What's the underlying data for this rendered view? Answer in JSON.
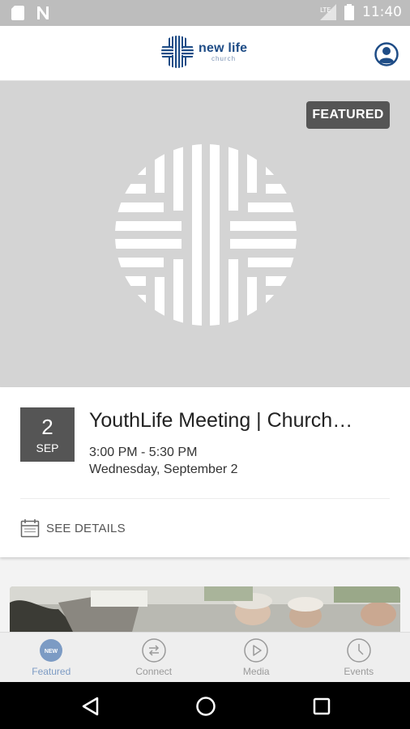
{
  "status_bar": {
    "time": "11:40",
    "icons": [
      "sd-card-icon",
      "notification-n-icon",
      "signal-icon",
      "battery-icon"
    ]
  },
  "app_bar": {
    "logo_text": "new life",
    "logo_subtext": "church",
    "profile_icon": "account-circle-icon"
  },
  "hero": {
    "badge": "FEATURED"
  },
  "event": {
    "day": "2",
    "month": "SEP",
    "title": "YouthLife Meeting | Church…",
    "time": "3:00 PM - 5:30 PM",
    "date": "Wednesday, September 2",
    "details_label": "SEE DETAILS"
  },
  "bottom_nav": {
    "items": [
      {
        "label": "Featured",
        "icon": "new-badge-icon",
        "badge_text": "NEW",
        "active": true
      },
      {
        "label": "Connect",
        "icon": "swap-icon",
        "active": false
      },
      {
        "label": "Media",
        "icon": "play-icon",
        "active": false
      },
      {
        "label": "Events",
        "icon": "clock-icon",
        "active": false
      }
    ]
  },
  "colors": {
    "brand": "#1e4c86",
    "active_nav": "#7c9bc4",
    "badge_bg": "#555555",
    "hero_bg": "#d4d4d4"
  }
}
